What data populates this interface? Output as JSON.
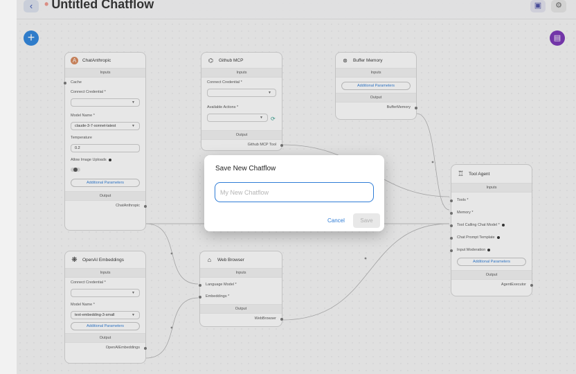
{
  "header": {
    "back_icon": "chevron-left-icon",
    "title": "Untitled Chatflow",
    "title_marker": "•",
    "save_icon": "save-icon",
    "settings_icon": "gear-icon"
  },
  "fab": {
    "add_icon": "plus-icon",
    "chat_icon": "chat-icon"
  },
  "nodes": {
    "chat_anthropic": {
      "title": "ChatAnthropic",
      "inputs_label": "Inputs",
      "cache_label": "Cache",
      "credential_label": "Connect Credential *",
      "model_label": "Model Name *",
      "model_value": "claude-3-7-sonnet-latest",
      "temperature_label": "Temperature",
      "temperature_value": "0.2",
      "uploads_label": "Allow Image Uploads",
      "additional_label": "Additional Parameters",
      "output_label": "Output",
      "output_value": "ChatAnthropic"
    },
    "github_mcp": {
      "title": "Github MCP",
      "inputs_label": "Inputs",
      "credential_label": "Connect Credential *",
      "actions_label": "Available Actions *",
      "output_label": "Output",
      "output_value": "Github MCP Tool"
    },
    "buffer_memory": {
      "title": "Buffer Memory",
      "inputs_label": "Inputs",
      "additional_label": "Additional Parameters",
      "output_label": "Output",
      "output_value": "BufferMemory"
    },
    "tool_agent": {
      "title": "Tool Agent",
      "inputs_label": "Inputs",
      "tools_label": "Tools *",
      "memory_label": "Memory *",
      "model_label": "Tool Calling Chat Model *",
      "prompt_label": "Chat Prompt Template",
      "moderation_label": "Input Moderation",
      "additional_label": "Additional Parameters",
      "output_label": "Output",
      "output_value": "AgentExecutor"
    },
    "openai_embeddings": {
      "title": "OpenAI Embeddings",
      "inputs_label": "Inputs",
      "credential_label": "Connect Credential *",
      "model_label": "Model Name *",
      "model_value": "text-embedding-3-small",
      "additional_label": "Additional Parameters",
      "output_label": "Output",
      "output_value": "OpenAIEmbeddings"
    },
    "web_browser": {
      "title": "Web Browser",
      "inputs_label": "Inputs",
      "language_model_label": "Language Model *",
      "embeddings_label": "Embeddings *",
      "output_label": "Output",
      "output_value": "WebBrowser"
    }
  },
  "modal": {
    "title": "Save New Chatflow",
    "input_placeholder": "My New Chatflow",
    "input_value": "",
    "cancel_label": "Cancel",
    "save_label": "Save"
  },
  "colors": {
    "accent": "#2e7cd6",
    "fab_add": "#2e86de",
    "fab_chat": "#7a35b8",
    "unsaved_marker": "#f19a8f"
  }
}
